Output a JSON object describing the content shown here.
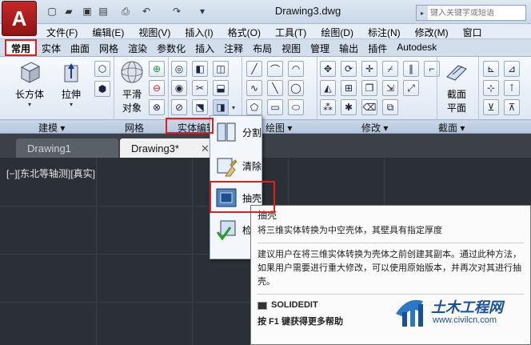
{
  "window": {
    "title": "Drawing3.dwg",
    "search_placeholder": "键入关键字或短语"
  },
  "menubar": [
    "文件(F)",
    "编辑(E)",
    "视图(V)",
    "插入(I)",
    "格式(O)",
    "工具(T)",
    "绘图(D)",
    "标注(N)",
    "修改(M)",
    "窗口"
  ],
  "ribbon_tabs": [
    "常用",
    "实体",
    "曲面",
    "网格",
    "渲染",
    "参数化",
    "插入",
    "注释",
    "布局",
    "视图",
    "管理",
    "输出",
    "插件",
    "Autodesk"
  ],
  "ribbon": {
    "box_label": "长方体",
    "extrude_label": "拉伸",
    "smooth_label1": "平滑",
    "smooth_label2": "对象",
    "section_label1": "截面",
    "section_label2": "平面"
  },
  "panels": [
    "建模",
    "网格",
    "实体编辑",
    "绘图",
    "修改",
    "截面"
  ],
  "file_tabs": [
    "Drawing1",
    "Drawing3*"
  ],
  "viewport_label": "[−][东北等轴测][真实]",
  "dropdown": {
    "items": [
      "分割",
      "清除",
      "抽壳",
      "检"
    ]
  },
  "tooltip": {
    "title": "抽壳",
    "desc": "将三维实体转换为中空壳体，其壁具有指定厚度",
    "detail": "建议用户在将三维实体转换为壳体之前创建其副本。通过此种方法，如果用户需要进行重大修改，可以使用原始版本，并再次对其进行抽壳。",
    "command": "SOLIDEDIT",
    "help": "按 F1 键获得更多帮助"
  },
  "watermark": {
    "name": "土木工程网",
    "url": "www.civilcn.com"
  },
  "colors": {
    "highlight": "#e02020",
    "app_red": "#c62828",
    "viewport": "#2b3036"
  }
}
